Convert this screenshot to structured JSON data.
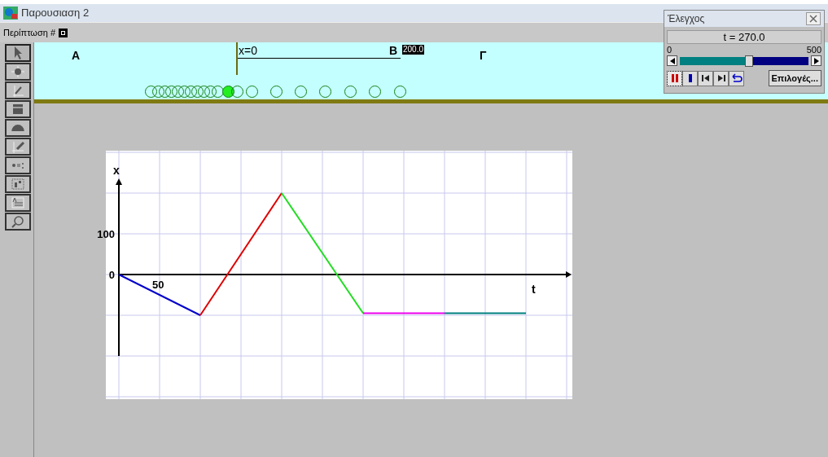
{
  "window": {
    "title": "Παρουσιαση 2"
  },
  "menu": {
    "label": "Περίπτωση #"
  },
  "tools": [
    {
      "kind": "arrow",
      "selected": true
    },
    {
      "kind": "point",
      "selected": false
    },
    {
      "kind": "vector",
      "selected": false
    },
    {
      "kind": "block",
      "selected": false
    },
    {
      "kind": "gauge",
      "selected": false
    },
    {
      "kind": "graph",
      "selected": false
    },
    {
      "kind": "equation",
      "selected": false
    },
    {
      "kind": "image",
      "selected": false
    },
    {
      "kind": "text",
      "selected": false
    },
    {
      "kind": "zoom",
      "selected": false
    }
  ],
  "scene": {
    "labels": [
      "A",
      "Γ"
    ],
    "origin_label": "x=0",
    "end_label": "B",
    "end_value": "200.0",
    "trail": [
      {
        "selected": false
      },
      {
        "selected": false
      },
      {
        "selected": false
      },
      {
        "selected": false
      },
      {
        "selected": false
      },
      {
        "selected": false
      },
      {
        "selected": false
      },
      {
        "selected": false
      },
      {
        "selected": false
      },
      {
        "selected": false
      },
      {
        "selected": false
      },
      {
        "selected": true
      },
      {
        "selected": false
      },
      {
        "selected": false
      },
      {
        "selected": false
      },
      {
        "selected": false
      },
      {
        "selected": false
      },
      {
        "selected": false
      },
      {
        "selected": false
      },
      {
        "selected": false
      }
    ]
  },
  "graph": {
    "x_axis_label": "t",
    "y_axis_label": "x",
    "y_tick_labels": [
      "100",
      "0"
    ],
    "x_tick_label": "50"
  },
  "control": {
    "title": "Έλεγχος",
    "time": "t =  270.0",
    "min": "0",
    "max": "500",
    "level": 0.54,
    "buttons": [
      {
        "kind": "pause",
        "selected": true
      },
      {
        "kind": "stop",
        "selected": false
      },
      {
        "kind": "rewind",
        "selected": false
      },
      {
        "kind": "step",
        "selected": false
      },
      {
        "kind": "loop",
        "selected": false
      }
    ],
    "options": "Επιλογές..."
  }
}
